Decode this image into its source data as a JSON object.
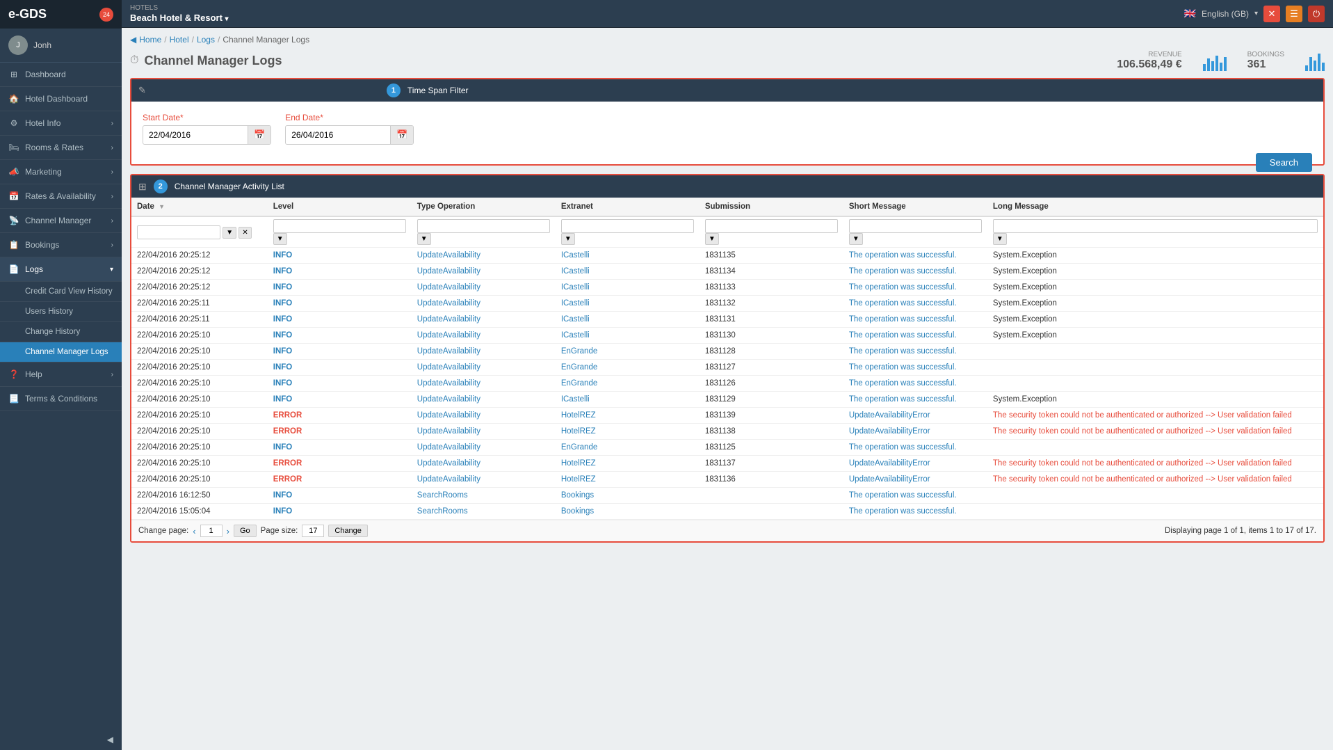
{
  "app": {
    "name": "e-GDS"
  },
  "topbar": {
    "hotel_section": "HOTELS",
    "hotel_name": "Beach Hotel & Resort",
    "language": "English (GB)",
    "notif_count": "24"
  },
  "sidebar": {
    "user": "Jonh",
    "items": [
      {
        "id": "dashboard",
        "label": "Dashboard",
        "icon": "⊞"
      },
      {
        "id": "hotel-dashboard",
        "label": "Hotel Dashboard",
        "icon": "🏠"
      },
      {
        "id": "hotel-info",
        "label": "Hotel Info",
        "icon": "⚙",
        "has_arrow": true
      },
      {
        "id": "rooms-rates",
        "label": "Rooms & Rates",
        "icon": "🛏",
        "has_arrow": true
      },
      {
        "id": "marketing",
        "label": "Marketing",
        "icon": "📣",
        "has_arrow": true
      },
      {
        "id": "rates-availability",
        "label": "Rates & Availability",
        "icon": "📅",
        "has_arrow": true
      },
      {
        "id": "channel-manager",
        "label": "Channel Manager",
        "icon": "📡",
        "has_arrow": true
      },
      {
        "id": "bookings",
        "label": "Bookings",
        "icon": "📋",
        "has_arrow": true
      },
      {
        "id": "logs",
        "label": "Logs",
        "icon": "📄",
        "active": true,
        "has_arrow": true
      }
    ],
    "logs_sub": [
      {
        "id": "credit-card-view",
        "label": "Credit Card View History"
      },
      {
        "id": "users-history",
        "label": "Users History"
      },
      {
        "id": "change-history",
        "label": "Change History"
      },
      {
        "id": "channel-manager-logs",
        "label": "Channel Manager Logs",
        "active": true
      }
    ],
    "bottom_items": [
      {
        "id": "help",
        "label": "Help",
        "icon": "❓",
        "has_arrow": true
      },
      {
        "id": "terms",
        "label": "Terms & Conditions",
        "icon": "📃"
      }
    ]
  },
  "breadcrumb": {
    "items": [
      "Home",
      "Hotel",
      "Logs",
      "Channel Manager Logs"
    ]
  },
  "page": {
    "title": "Channel Manager Logs",
    "icon": "⏱"
  },
  "stats": {
    "revenue_label": "REVENUE",
    "revenue_value": "106.568,49 €",
    "bookings_label": "BOOKINGS",
    "bookings_value": "361"
  },
  "filter": {
    "step_label": "1",
    "tooltip": "Time Span Filter",
    "start_date_label": "Start Date",
    "start_date_value": "22/04/2016",
    "end_date_label": "End Date",
    "end_date_value": "26/04/2016",
    "search_btn": "Search"
  },
  "table": {
    "step_label": "2",
    "tooltip": "Channel Manager Activity List",
    "columns": [
      "Date",
      "Level",
      "Type Operation",
      "Extranet",
      "Submission",
      "Short Message",
      "Long Message"
    ],
    "rows": [
      {
        "date": "22/04/2016 20:25:12",
        "level": "INFO",
        "type": "UpdateAvailability",
        "extranet": "ICastelli",
        "submission": "1831135",
        "short": "The operation was successful.",
        "long": "System.Exception",
        "level_class": "info"
      },
      {
        "date": "22/04/2016 20:25:12",
        "level": "INFO",
        "type": "UpdateAvailability",
        "extranet": "ICastelli",
        "submission": "1831134",
        "short": "The operation was successful.",
        "long": "System.Exception",
        "level_class": "info"
      },
      {
        "date": "22/04/2016 20:25:12",
        "level": "INFO",
        "type": "UpdateAvailability",
        "extranet": "ICastelli",
        "submission": "1831133",
        "short": "The operation was successful.",
        "long": "System.Exception",
        "level_class": "info"
      },
      {
        "date": "22/04/2016 20:25:11",
        "level": "INFO",
        "type": "UpdateAvailability",
        "extranet": "ICastelli",
        "submission": "1831132",
        "short": "The operation was successful.",
        "long": "System.Exception",
        "level_class": "info"
      },
      {
        "date": "22/04/2016 20:25:11",
        "level": "INFO",
        "type": "UpdateAvailability",
        "extranet": "ICastelli",
        "submission": "1831131",
        "short": "The operation was successful.",
        "long": "System.Exception",
        "level_class": "info"
      },
      {
        "date": "22/04/2016 20:25:10",
        "level": "INFO",
        "type": "UpdateAvailability",
        "extranet": "ICastelli",
        "submission": "1831130",
        "short": "The operation was successful.",
        "long": "System.Exception",
        "level_class": "info"
      },
      {
        "date": "22/04/2016 20:25:10",
        "level": "INFO",
        "type": "UpdateAvailability",
        "extranet": "EnGrande",
        "submission": "1831128",
        "short": "The operation was successful.",
        "long": "",
        "level_class": "info"
      },
      {
        "date": "22/04/2016 20:25:10",
        "level": "INFO",
        "type": "UpdateAvailability",
        "extranet": "EnGrande",
        "submission": "1831127",
        "short": "The operation was successful.",
        "long": "",
        "level_class": "info"
      },
      {
        "date": "22/04/2016 20:25:10",
        "level": "INFO",
        "type": "UpdateAvailability",
        "extranet": "EnGrande",
        "submission": "1831126",
        "short": "The operation was successful.",
        "long": "",
        "level_class": "info"
      },
      {
        "date": "22/04/2016 20:25:10",
        "level": "INFO",
        "type": "UpdateAvailability",
        "extranet": "ICastelli",
        "submission": "1831129",
        "short": "The operation was successful.",
        "long": "System.Exception",
        "level_class": "info"
      },
      {
        "date": "22/04/2016 20:25:10",
        "level": "ERROR",
        "type": "UpdateAvailability",
        "extranet": "HotelREZ",
        "submission": "1831139",
        "short": "UpdateAvailabilityError",
        "long": "The security token could not be authenticated or authorized --> User validation failed",
        "level_class": "error"
      },
      {
        "date": "22/04/2016 20:25:10",
        "level": "ERROR",
        "type": "UpdateAvailability",
        "extranet": "HotelREZ",
        "submission": "1831138",
        "short": "UpdateAvailabilityError",
        "long": "The security token could not be authenticated or authorized --> User validation failed",
        "level_class": "error"
      },
      {
        "date": "22/04/2016 20:25:10",
        "level": "INFO",
        "type": "UpdateAvailability",
        "extranet": "EnGrande",
        "submission": "1831125",
        "short": "The operation was successful.",
        "long": "",
        "level_class": "info"
      },
      {
        "date": "22/04/2016 20:25:10",
        "level": "ERROR",
        "type": "UpdateAvailability",
        "extranet": "HotelREZ",
        "submission": "1831137",
        "short": "UpdateAvailabilityError",
        "long": "The security token could not be authenticated or authorized --> User validation failed",
        "level_class": "error"
      },
      {
        "date": "22/04/2016 20:25:10",
        "level": "ERROR",
        "type": "UpdateAvailability",
        "extranet": "HotelREZ",
        "submission": "1831136",
        "short": "UpdateAvailabilityError",
        "long": "The security token could not be authenticated or authorized --> User validation failed",
        "level_class": "error"
      },
      {
        "date": "22/04/2016 16:12:50",
        "level": "INFO",
        "type": "SearchRooms",
        "extranet": "Bookings",
        "submission": "",
        "short": "The operation was successful.",
        "long": "",
        "level_class": "info"
      },
      {
        "date": "22/04/2016 15:05:04",
        "level": "INFO",
        "type": "SearchRooms",
        "extranet": "Bookings",
        "submission": "",
        "short": "The operation was successful.",
        "long": "",
        "level_class": "info"
      }
    ]
  },
  "pagination": {
    "change_page_label": "Change page:",
    "current_page": "1",
    "go_label": "Go",
    "page_size_label": "Page size:",
    "page_size": "17",
    "change_label": "Change",
    "display_info": "Displaying page 1 of 1, items 1 to 17 of 17."
  }
}
